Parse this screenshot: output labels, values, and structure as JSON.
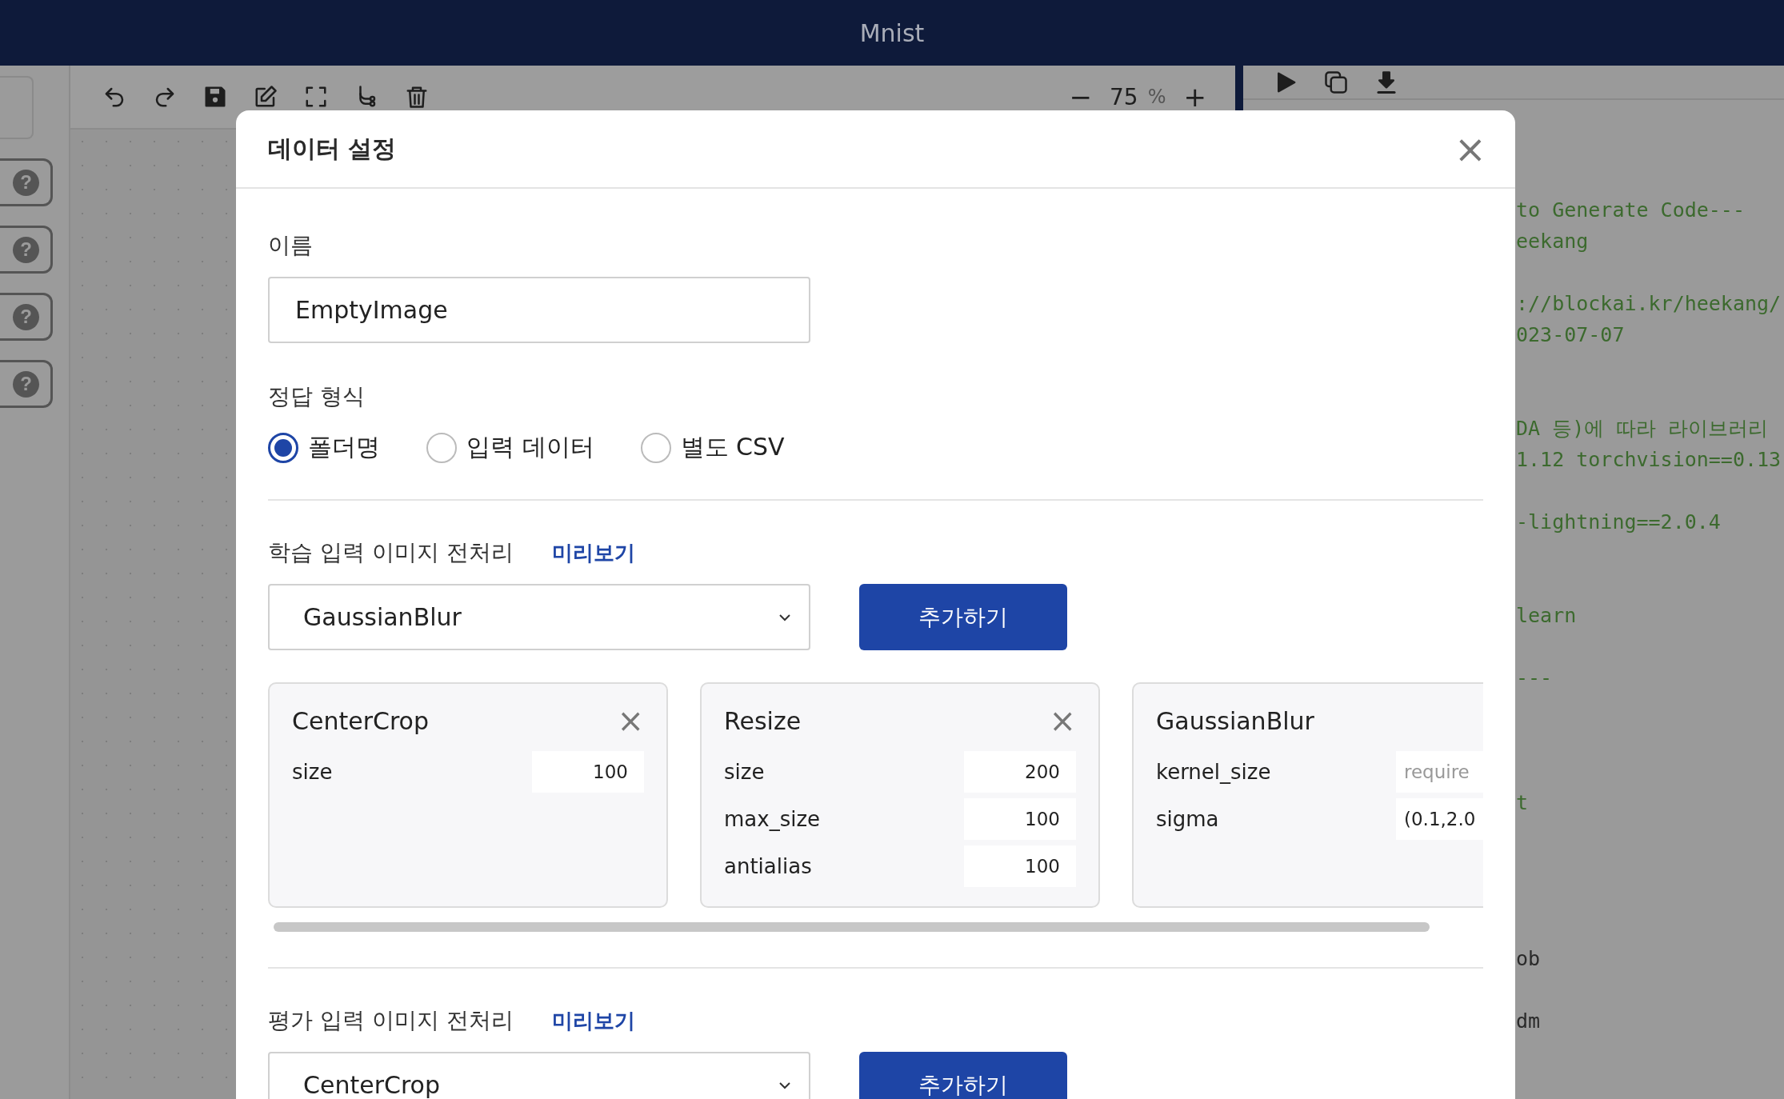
{
  "window": {
    "title": "Mnist"
  },
  "sidebar": {
    "help_buttons": [
      "?",
      "?",
      "?",
      "?"
    ]
  },
  "toolbar": {
    "zoom_out": "−",
    "zoom_value": "75",
    "zoom_unit": "%",
    "zoom_in": "+"
  },
  "code_panel": {
    "lines": [
      {
        "kind": "comment",
        "text": "to Generate Code---"
      },
      {
        "kind": "comment",
        "text": "eekang"
      },
      {
        "kind": "blank"
      },
      {
        "kind": "comment",
        "text": "://blockai.kr/heekang/"
      },
      {
        "kind": "comment",
        "text": "023-07-07"
      },
      {
        "kind": "blank"
      },
      {
        "kind": "blank"
      },
      {
        "kind": "comment",
        "text": "DA 등)에 따라 라이브러리"
      },
      {
        "kind": "comment",
        "text": "1.12 torchvision==0.13"
      },
      {
        "kind": "blank"
      },
      {
        "kind": "comment",
        "text": "-lightning==2.0.4"
      },
      {
        "kind": "blank"
      },
      {
        "kind": "blank"
      },
      {
        "kind": "comment",
        "text": "learn"
      },
      {
        "kind": "blank"
      },
      {
        "kind": "comment",
        "text": "---"
      },
      {
        "kind": "blank"
      },
      {
        "kind": "blank"
      },
      {
        "kind": "blank"
      },
      {
        "kind": "comment",
        "text": "t"
      },
      {
        "kind": "blank"
      },
      {
        "kind": "blank"
      },
      {
        "kind": "blank"
      },
      {
        "kind": "blank"
      },
      {
        "kind": "code",
        "text": "ob"
      },
      {
        "kind": "blank"
      },
      {
        "kind": "code",
        "text": "dm"
      }
    ]
  },
  "dialog": {
    "title": "데이터 설정",
    "close": "×",
    "name_label": "이름",
    "name_value": "EmptyImage",
    "answer_label": "정답 형식",
    "answer_options": [
      {
        "label": "폴더명",
        "selected": true
      },
      {
        "label": "입력 데이터",
        "selected": false
      },
      {
        "label": "별도 CSV",
        "selected": false
      }
    ],
    "sections": [
      {
        "title": "학습 입력 이미지 전처리",
        "preview_link": "미리보기",
        "select_value": "GaussianBlur",
        "add_button": "추가하기",
        "cards": [
          {
            "title": "CenterCrop",
            "close": "×",
            "params": [
              {
                "name": "size",
                "value": "100"
              }
            ]
          },
          {
            "title": "Resize",
            "close": "×",
            "params": [
              {
                "name": "size",
                "value": "200"
              },
              {
                "name": "max_size",
                "value": "100"
              },
              {
                "name": "antialias",
                "value": "100"
              }
            ]
          },
          {
            "title": "GaussianBlur",
            "params": [
              {
                "name": "kernel_size",
                "placeholder": "require"
              },
              {
                "name": "sigma",
                "value": "(0.1,2.0"
              }
            ]
          }
        ]
      },
      {
        "title": "평가 입력 이미지 전처리",
        "preview_link": "미리보기",
        "select_value": "CenterCrop",
        "add_button": "추가하기"
      }
    ]
  }
}
